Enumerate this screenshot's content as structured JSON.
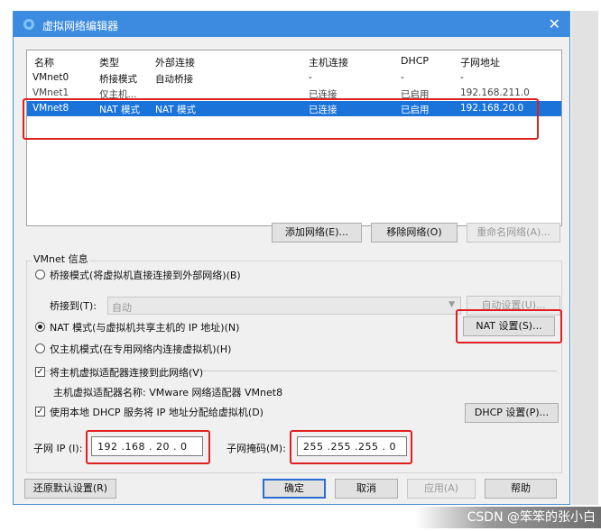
{
  "window": {
    "title": "虚拟网络编辑器",
    "close_glyph": "✕"
  },
  "table": {
    "headers": [
      "名称",
      "类型",
      "外部连接",
      "主机连接",
      "DHCP",
      "子网地址"
    ],
    "rows": [
      [
        "VMnet0",
        "桥接模式",
        "自动桥接",
        "-",
        "-",
        "-"
      ],
      [
        "VMnet1",
        "仅主机...",
        "",
        "已连接",
        "已启用",
        "192.168.211.0"
      ],
      [
        "VMnet8",
        "NAT 模式",
        "NAT 模式",
        "已连接",
        "已启用",
        "192.168.20.0"
      ]
    ]
  },
  "buttons": {
    "add_network": "添加网络(E)...",
    "remove_network": "移除网络(O)",
    "rename_network": "重命名网络(A)...",
    "auto_settings": "自动设置(U)...",
    "nat_settings": "NAT 设置(S)...",
    "dhcp_settings": "DHCP 设置(P)...",
    "restore_defaults": "还原默认设置(R)",
    "ok": "确定",
    "cancel": "取消",
    "apply": "应用(A)",
    "help": "帮助"
  },
  "vmnet_info": {
    "legend": "VMnet 信息",
    "bridged_label": "桥接模式(将虚拟机直接连接到外部网络)(B)",
    "bridged_to_label": "桥接到(T):",
    "bridged_to_value": "自动",
    "nat_label": "NAT 模式(与虚拟机共享主机的 IP 地址)(N)",
    "hostonly_label": "仅主机模式(在专用网络内连接虚拟机)(H)",
    "connect_adapter_label": "将主机虚拟适配器连接到此网络(V)",
    "adapter_name_text": "主机虚拟适配器名称: VMware 网络适配器 VMnet8",
    "use_dhcp_label": "使用本地 DHCP 服务将 IP 地址分配给虚拟机(D)",
    "subnet_ip_label": "子网 IP (I):",
    "subnet_ip_value": "192 .168 . 20 . 0",
    "subnet_mask_label": "子网掩码(M):",
    "subnet_mask_value": "255 .255 .255 . 0"
  },
  "watermark": "CSDN @笨笨的张小白",
  "colors": {
    "titlebar": "#3c8be0",
    "selection": "#1a73d9",
    "highlight": "#e02020"
  }
}
